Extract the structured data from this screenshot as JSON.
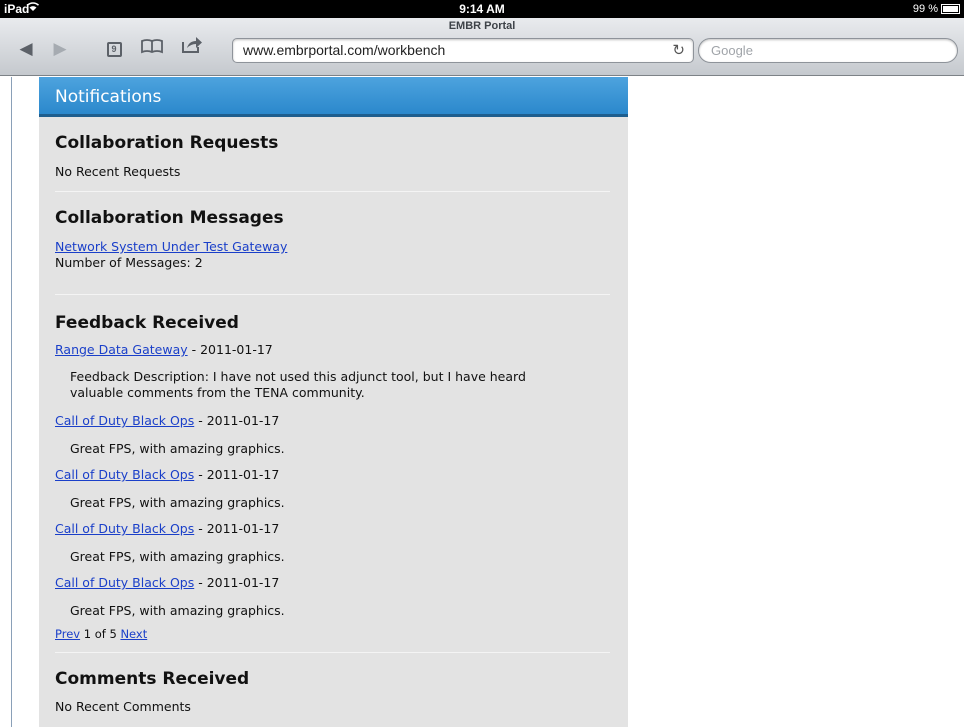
{
  "status_bar": {
    "carrier": "iPad",
    "time": "9:14 AM",
    "battery": "99 %",
    "battery_level": 0.99
  },
  "browser": {
    "page_title": "EMBR Portal",
    "url": "www.embrportal.com/workbench",
    "search_placeholder": "Google",
    "tab_count": "9"
  },
  "notifications": {
    "header": "Notifications",
    "collaboration_requests": {
      "title": "Collaboration Requests",
      "empty_text": "No Recent Requests"
    },
    "collaboration_messages": {
      "title": "Collaboration Messages",
      "link": "Network System Under Test Gateway",
      "count_text": "Number of Messages: 2"
    },
    "feedback_received": {
      "title": "Feedback Received",
      "items": [
        {
          "link": "Range Data Gateway",
          "date": " - 2011-01-17",
          "description_line1": "Feedback Description: I have not used this adjunct tool, but I have heard",
          "description_line2": "valuable comments from the TENA community."
        },
        {
          "link": "Call of Duty Black Ops",
          "date": " - 2011-01-17",
          "description": "Great FPS, with amazing graphics."
        },
        {
          "link": "Call of Duty Black Ops",
          "date": " - 2011-01-17",
          "description": "Great FPS, with amazing graphics."
        },
        {
          "link": "Call of Duty Black Ops",
          "date": " - 2011-01-17",
          "description": "Great FPS, with amazing graphics."
        },
        {
          "link": "Call of Duty Black Ops",
          "date": " - 2011-01-17",
          "description": "Great FPS, with amazing graphics."
        }
      ],
      "pager": {
        "prev": "Prev",
        "page_text": " 1 of 5 ",
        "next": "Next"
      }
    },
    "comments_received": {
      "title": "Comments Received",
      "empty_text": "No Recent Comments"
    }
  }
}
